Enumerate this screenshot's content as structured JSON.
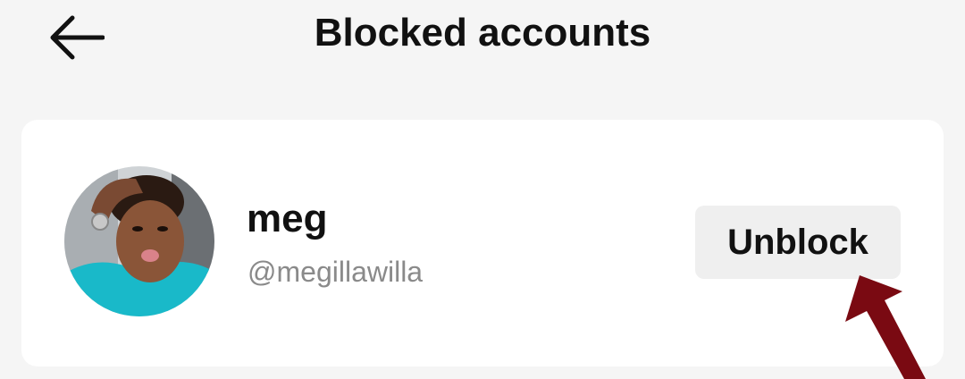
{
  "header": {
    "back_icon": "arrow-left-icon",
    "title": "Blocked accounts"
  },
  "blocked_list": [
    {
      "display_name": "meg",
      "handle": "@megillawilla",
      "action_label": "Unblock"
    }
  ],
  "colors": {
    "background": "#f5f5f5",
    "card": "#ffffff",
    "button_bg": "#efefef",
    "handle_text": "#8a8a8a",
    "annotation_arrow": "#7a0a12"
  }
}
